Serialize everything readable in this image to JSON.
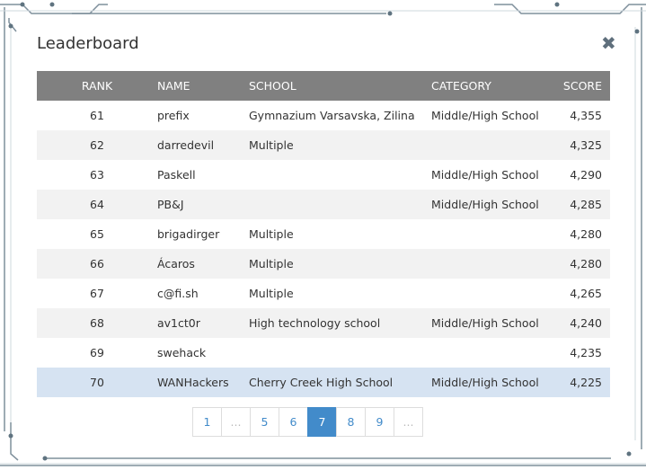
{
  "title": "Leaderboard",
  "close_icon": "close-x-icon",
  "columns": {
    "rank": "RANK",
    "name": "NAME",
    "school": "SCHOOL",
    "category": "CATEGORY",
    "score": "SCORE"
  },
  "rows": [
    {
      "rank": "61",
      "name": "prefix",
      "school": "Gymnazium Varsavska, Zilina",
      "category": "Middle/High School",
      "score": "4,355"
    },
    {
      "rank": "62",
      "name": "darredevil",
      "school": "Multiple",
      "category": "",
      "score": "4,325"
    },
    {
      "rank": "63",
      "name": "Paskell",
      "school": "",
      "category": "Middle/High School",
      "score": "4,290"
    },
    {
      "rank": "64",
      "name": "PB&J",
      "school": "",
      "category": "Middle/High School",
      "score": "4,285"
    },
    {
      "rank": "65",
      "name": "brigadirger",
      "school": "Multiple",
      "category": "",
      "score": "4,280"
    },
    {
      "rank": "66",
      "name": "Ácaros",
      "school": "Multiple",
      "category": "",
      "score": "4,280"
    },
    {
      "rank": "67",
      "name": "c@fi.sh",
      "school": "Multiple",
      "category": "",
      "score": "4,265"
    },
    {
      "rank": "68",
      "name": "av1ct0r",
      "school": "High technology school",
      "category": "Middle/High School",
      "score": "4,240"
    },
    {
      "rank": "69",
      "name": "swehack",
      "school": "",
      "category": "",
      "score": "4,235"
    },
    {
      "rank": "70",
      "name": "WANHackers",
      "school": "Cherry Creek High School",
      "category": "Middle/High School",
      "score": "4,225"
    }
  ],
  "highlight_color": "#d6e3f2",
  "pagination": {
    "pages": [
      "1",
      "...",
      "5",
      "6",
      "7",
      "8",
      "9",
      "..."
    ],
    "current": "7"
  }
}
